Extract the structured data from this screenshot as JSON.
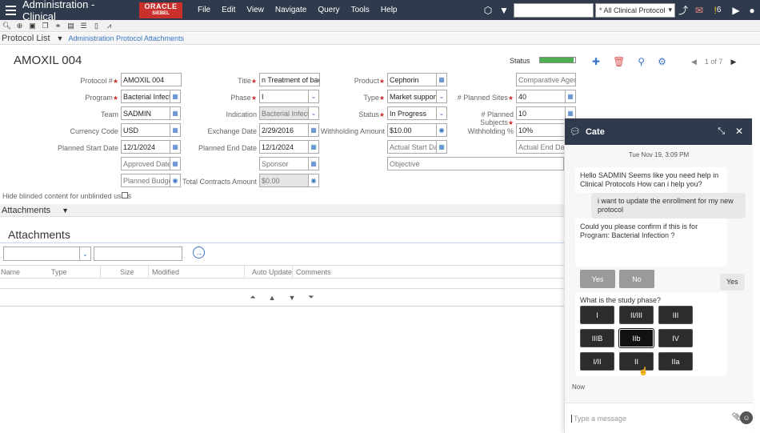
{
  "app": {
    "title": "Administration - Clinical",
    "logo_top": "ORACLE",
    "logo_bottom": "SIEBEL",
    "menu": [
      "File",
      "Edit",
      "View",
      "Navigate",
      "Query",
      "Tools",
      "Help"
    ],
    "protocol_scope": "* All Clinical Protocol",
    "notif_count": "6"
  },
  "breadcrumb": {
    "view": "Protocol List",
    "link": "Administration Protocol Attachments"
  },
  "record": {
    "title": "AMOXIL 004",
    "status_label": "Status",
    "status_progress": 0.95,
    "pager": "1 of 7"
  },
  "form": {
    "protocol_label": "Protocol #",
    "protocol": "AMOXIL 004",
    "title_label": "Title",
    "title": "n Treatment of bact",
    "product_label": "Product",
    "product": "Cephorin",
    "comparative": "Comparative Agent",
    "program_label": "Program",
    "program": "Bacterial Infectio",
    "phase_label": "Phase",
    "phase": "I",
    "type_label": "Type",
    "type": "Market support",
    "planned_sites_label": "# Planned Sites",
    "planned_sites": "40",
    "team_label": "Team",
    "team": "SADMIN",
    "indication_label": "Indication",
    "indication": "Bacterial Infectio",
    "status_label": "Status",
    "status": "In Progress",
    "planned_subjects_label": "# Planned Subjects",
    "planned_subjects": "10",
    "currency_label": "Currency Code",
    "currency": "USD",
    "exchange_label": "Exchange Date",
    "exchange": "2/29/2016",
    "withholding_amt_label": "Withholding Amount",
    "withholding_amt": "$10.00",
    "withholding_pct_label": "Withholding %",
    "withholding_pct": "10%",
    "pstart_label": "Planned Start Date",
    "pstart": "12/1/2024",
    "pend_label": "Planned End Date",
    "pend": "12/1/2024",
    "astart": "Actual Start Dat",
    "aend": "Actual End Date",
    "approved": "Approved Date",
    "sponsor": "Sponsor",
    "objective": "Objective",
    "budget": "Planned Budget",
    "total_contracts_label": "Total Contracts Amount",
    "total_contracts": "$0.00",
    "hide_blinded_label": "Hide blinded content for unblinded users"
  },
  "attachments": {
    "bar_title": "Attachments",
    "heading": "Attachments",
    "columns": [
      "Name",
      "Type",
      "Size",
      "Modified",
      "Auto Update",
      "Comments"
    ]
  },
  "chat": {
    "agent": "Cate",
    "timestamp": "Tue Nov 19, 3:09 PM",
    "msg1": "Hello SADMIN Seems like you need help in Clinical Protocols How can i help you?",
    "msg2": "i want to update the enrollment for my new protocol",
    "msg3": "Could you please confirm if this is for Program: Bacterial Infection ?",
    "yes_label": "Yes",
    "no_label": "No",
    "user_yes": "Yes",
    "msg4": "What is the study phase?",
    "phases": [
      "I",
      "II/III",
      "III",
      "IIIB",
      "IIb",
      "IV",
      "I/II",
      "II",
      "IIa"
    ],
    "selected_phase": "IIb",
    "now": "Now",
    "placeholder": "Type a message"
  }
}
